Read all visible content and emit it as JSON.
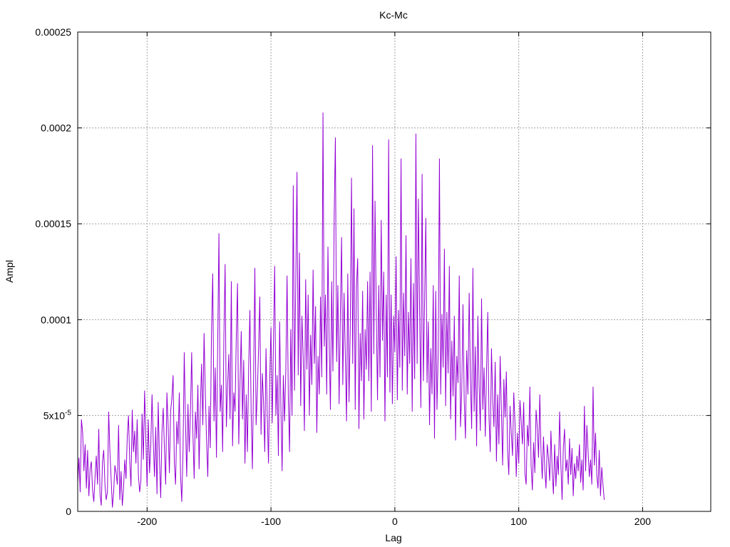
{
  "chart_data": {
    "type": "line",
    "title": "Kc-Mc",
    "xlabel": "Lag",
    "ylabel": "Ampl",
    "xlim": [
      -256,
      255
    ],
    "ylim": [
      0,
      0.00025
    ],
    "grid": true,
    "x_ticks": [
      -200,
      -100,
      0,
      100,
      200
    ],
    "x_tick_labels": [
      "-200",
      "-100",
      "0",
      "100",
      "200"
    ],
    "y_ticks": [
      0,
      5e-05,
      0.0001,
      0.00015,
      0.0002,
      0.00025
    ],
    "y_tick_labels": [
      "0",
      "5x10",
      "0.0001",
      "0.00015",
      "0.0002",
      "0.00025"
    ],
    "y_tick_label_exponent": "-5",
    "series": [
      {
        "color": "#9400d3",
        "x_start": -256,
        "x_step": 1,
        "values": [
          1.5e-05,
          2.8e-05,
          1e-05,
          4.8e-05,
          4.1e-05,
          2.1e-05,
          3.5e-05,
          1.2e-05,
          3.2e-05,
          8e-06,
          2.2e-05,
          2.6e-05,
          1.1e-05,
          5e-06,
          1.8e-05,
          2.9e-05,
          1.4e-05,
          4.3e-05,
          9e-06,
          3e-06,
          2.6e-05,
          3.2e-05,
          1.4e-05,
          6e-06,
          1e-05,
          5.2e-05,
          3.1e-05,
          1.7e-05,
          2e-06,
          1e-05,
          2.4e-05,
          2e-05,
          1.4e-05,
          4.5e-05,
          6e-06,
          2.1e-05,
          3e-06,
          1.2e-05,
          2.7e-05,
          1.7e-05,
          3.9e-05,
          5e-05,
          2.6e-05,
          1.3e-05,
          5.3e-05,
          3.1e-05,
          4.2e-05,
          2.5e-05,
          4.8e-05,
          1.9e-05,
          1e-05,
          1.6e-05,
          5.1e-05,
          2.7e-05,
          6.3e-05,
          3.8e-05,
          1.3e-05,
          4.8e-05,
          2e-05,
          3.5e-05,
          6.1e-05,
          3.6e-05,
          1.8e-05,
          4.4e-05,
          9e-06,
          5.7e-05,
          2.7e-05,
          7e-06,
          4.1e-05,
          5.4e-05,
          3.3e-05,
          1.4e-05,
          6.2e-05,
          4.5e-05,
          2e-05,
          5.2e-05,
          5.9e-05,
          7.1e-05,
          2.5e-05,
          1.4e-05,
          4.7e-05,
          3.5e-05,
          6.2e-05,
          1.9e-05,
          5e-06,
          3.1e-05,
          8.3e-05,
          4.6e-05,
          1.8e-05,
          5.6e-05,
          3.1e-05,
          5.2e-05,
          8.3e-05,
          4.1e-05,
          1.7e-05,
          5.2e-05,
          3.8e-05,
          6.6e-05,
          2.2e-05,
          5.5e-05,
          7.7e-05,
          4.5e-05,
          9.3e-05,
          6.2e-05,
          3.7e-05,
          1.8e-05,
          5.5e-05,
          3.3e-05,
          9.4e-05,
          0.000124,
          4.7e-05,
          7.5e-05,
          2.8e-05,
          8.7e-05,
          0.000145,
          5.2e-05,
          6.6e-05,
          3.1e-05,
          9.1e-05,
          0.000129,
          4.4e-05,
          6.6e-05,
          8.2e-05,
          4.8e-05,
          0.00012,
          3.4e-05,
          6.2e-05,
          5.2e-05,
          9.1e-05,
          0.000119,
          3.5e-05,
          6.6e-05,
          9.4e-05,
          4.8e-05,
          7.9e-05,
          2.5e-05,
          6.1e-05,
          3.1e-05,
          7.5e-05,
          0.000105,
          5.2e-05,
          2.2e-05,
          7.1e-05,
          0.000127,
          4.5e-05,
          6.2e-05,
          8.5e-05,
          0.000112,
          4e-05,
          7.2e-05,
          5.7e-05,
          3.1e-05,
          8.5e-05,
          5.1e-05,
          2.5e-05,
          6.9e-05,
          9.6e-05,
          4.6e-05,
          8.8e-05,
          0.000128,
          5e-05,
          7.1e-05,
          2.9e-05,
          9.9e-05,
          5.5e-05,
          2.1e-05,
          7.1e-05,
          4.7e-05,
          7.4e-05,
          0.000123,
          6e-05,
          3.1e-05,
          9.5e-05,
          5e-05,
          0.00017,
          6.3e-05,
          0.000118,
          0.000177,
          7.1e-05,
          0.000135,
          5.5e-05,
          0.000102,
          8.1e-05,
          4.2e-05,
          0.000121,
          7.4e-05,
          0.000113,
          5e-05,
          9.2e-05,
          6.6e-05,
          0.000126,
          7.7e-05,
          0.000107,
          4.1e-05,
          8.1e-05,
          6.1e-05,
          0.000112,
          7e-05,
          0.000208,
          8.6e-05,
          0.000113,
          6.1e-05,
          0.000138,
          8.8e-05,
          5.3e-05,
          0.00012,
          7.3e-05,
          0.000153,
          0.000195,
          7.8e-05,
          0.000118,
          5.6e-05,
          0.000102,
          0.000143,
          6.6e-05,
          0.000114,
          8.2e-05,
          4.7e-05,
          0.000124,
          5.7e-05,
          9.5e-05,
          0.000174,
          7.7e-05,
          0.000158,
          5.3e-05,
          0.000117,
          0.000132,
          4.3e-05,
          9.3e-05,
          6.8e-05,
          0.000115,
          4.8e-05,
          9.5e-05,
          7.4e-05,
          0.00012,
          6.8e-05,
          0.000125,
          5.2e-05,
          0.000191,
          8.2e-05,
          0.000162,
          0.000105,
          5.8e-05,
          0.000118,
          7e-05,
          0.000152,
          8.9e-05,
          0.000125,
          4.7e-05,
          0.000113,
          7e-05,
          0.000194,
          6.2e-05,
          0.000113,
          5.6e-05,
          0.000102,
          8.3e-05,
          0.000133,
          5.8e-05,
          0.000105,
          7.5e-05,
          0.000184,
          6.3e-05,
          0.000114,
          8.1e-05,
          0.000144,
          6.1e-05,
          0.000104,
          7.7e-05,
          0.000132,
          5.2e-05,
          0.000119,
          6.9e-05,
          0.000197,
          7.7e-05,
          0.000163,
          0.000104,
          5.4e-05,
          0.000176,
          6.8e-05,
          0.000109,
          0.000153,
          6.7e-05,
          9.9e-05,
          4.5e-05,
          8.5e-05,
          6.1e-05,
          0.000118,
          3.8e-05,
          0.000115,
          5.3e-05,
          8.3e-05,
          0.000184,
          6.1e-05,
          0.000103,
          7.5e-05,
          0.000137,
          5.5e-05,
          0.000104,
          7.2e-05,
          0.000128,
          4.8e-05,
          8.9e-05,
          6e-05,
          0.000102,
          3.7e-05,
          8.1e-05,
          6.7e-05,
          0.000123,
          4.4e-05,
          6.3e-05,
          0.000108,
          5.8e-05,
          3.8e-05,
          8.4e-05,
          6.1e-05,
          0.000114,
          6.9e-05,
          4.3e-05,
          0.000127,
          5.2e-05,
          8.6e-05,
          3.4e-05,
          0.000102,
          6.6e-05,
          4.2e-05,
          0.000111,
          5.3e-05,
          7.5e-05,
          3.9e-05,
          7.3e-05,
          0.000104,
          4.9e-05,
          3.1e-05,
          8.5e-05,
          5.8e-05,
          4.4e-05,
          7.8e-05,
          2.6e-05,
          6.1e-05,
          3.5e-05,
          8.1e-05,
          5.3e-05,
          2.4e-05,
          6.9e-05,
          4.9e-05,
          7.3e-05,
          3.2e-05,
          1.9e-05,
          5.5e-05,
          4.1e-05,
          2.9e-05,
          6.2e-05,
          4.6e-05,
          1.8e-05,
          4.1e-05,
          2.5e-05,
          5.8e-05,
          4.7e-05,
          3.5e-05,
          5.7e-05,
          2e-05,
          1.4e-05,
          4.5e-05,
          3.4e-05,
          6.5e-05,
          2.4e-05,
          1.1e-05,
          3.6e-05,
          2e-05,
          5.3e-05,
          4.4e-05,
          2.8e-05,
          6.1e-05,
          3.1e-05,
          1.7e-05,
          3.9e-05,
          2.2e-05,
          1.2e-05,
          3.5e-05,
          2.8e-05,
          1.6e-05,
          4.2e-05,
          2.1e-05,
          9e-06,
          3.5e-05,
          1.3e-05,
          2.9e-05,
          1.9e-05,
          5.2e-05,
          2.5e-05,
          6e-06,
          3.3e-05,
          4.3e-05,
          2.1e-05,
          2.7e-05,
          1.4e-05,
          3.8e-05,
          1.9e-05,
          3.3e-05,
          8e-06,
          2.5e-05,
          1.7e-05,
          2.9e-05,
          2.1e-05,
          3.5e-05,
          1.5e-05,
          2.7e-05,
          1.1e-05,
          5.5e-05,
          2.1e-05,
          4.5e-05,
          3.1e-05,
          1.8e-05,
          2.7e-05,
          1.4e-05,
          6.5e-05,
          2.4e-05,
          4.1e-05,
          1.9e-05,
          1.2e-05,
          3.2e-05,
          8e-06,
          2.3e-05,
          1.4e-05,
          6e-06
        ]
      }
    ]
  }
}
